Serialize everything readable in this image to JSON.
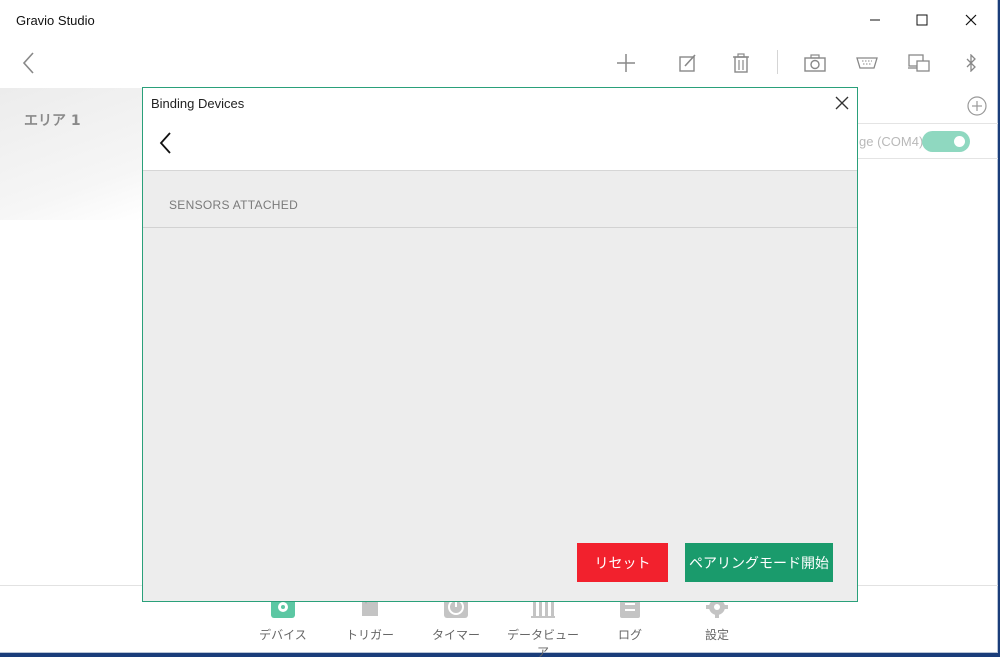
{
  "app": {
    "title": "Gravio Studio"
  },
  "window_controls": {
    "minimize": "minimize-icon",
    "maximize": "maximize-icon",
    "close": "close-icon"
  },
  "toolbar": {
    "icons": [
      "back-arrow-icon",
      "add-icon",
      "edit-icon",
      "delete-icon",
      "camera-icon",
      "serial-icon",
      "device-screen-icon",
      "bluetooth-icon"
    ]
  },
  "sidebar": {
    "area_label": "エリア 1"
  },
  "device_panel": {
    "port_label": "ge (COM4)",
    "toggle_on": true
  },
  "dialog": {
    "title": "Binding Devices",
    "section_header": "SENSORS ATTACHED",
    "reset_label": "リセット",
    "pairing_label": "ペアリングモード開始"
  },
  "bottom_nav": {
    "items": [
      {
        "label": "デバイス",
        "icon": "device-icon"
      },
      {
        "label": "トリガー",
        "icon": "trigger-icon"
      },
      {
        "label": "タイマー",
        "icon": "timer-icon"
      },
      {
        "label": "データビューア",
        "icon": "data-viewer-icon"
      },
      {
        "label": "ログ",
        "icon": "log-icon"
      },
      {
        "label": "設定",
        "icon": "settings-icon"
      }
    ]
  },
  "colors": {
    "accent_green": "#1a9b6c",
    "reset_red": "#f2212d",
    "toggle": "#8fd8c0"
  }
}
